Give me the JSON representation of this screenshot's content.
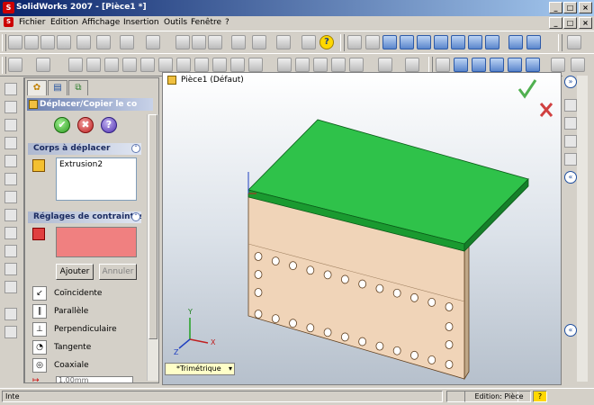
{
  "window": {
    "title": "SolidWorks 2007 - [Pièce1 *]"
  },
  "menu": {
    "items": [
      "Fichier",
      "Edition",
      "Affichage",
      "Insertion",
      "Outils",
      "Fenêtre"
    ],
    "help": "?"
  },
  "panel": {
    "title": "Déplacer/Copier le co",
    "bodies_section": "Corps à déplacer",
    "bodies": [
      "Extrusion2"
    ],
    "constraints_section": "Réglages de contraintes",
    "add_button": "Ajouter",
    "cancel_button": "Annuler",
    "constraints": [
      "Coïncidente",
      "Parallèle",
      "Perpendiculaire",
      "Tangente",
      "Coaxiale"
    ],
    "distance_value": "1.00mm"
  },
  "viewport": {
    "tree_label": "Pièce1 (Défaut)",
    "view_name": "*Trimétrique",
    "triad_labels": {
      "x": "X",
      "y": "Y",
      "z": "Z"
    },
    "colors": {
      "top_plate": "#2fc24a",
      "block": "#f0d4b8",
      "holes": "#ffffff"
    }
  },
  "status": {
    "left": "Inte",
    "mode": "Edition: Pièce",
    "help": "?"
  }
}
